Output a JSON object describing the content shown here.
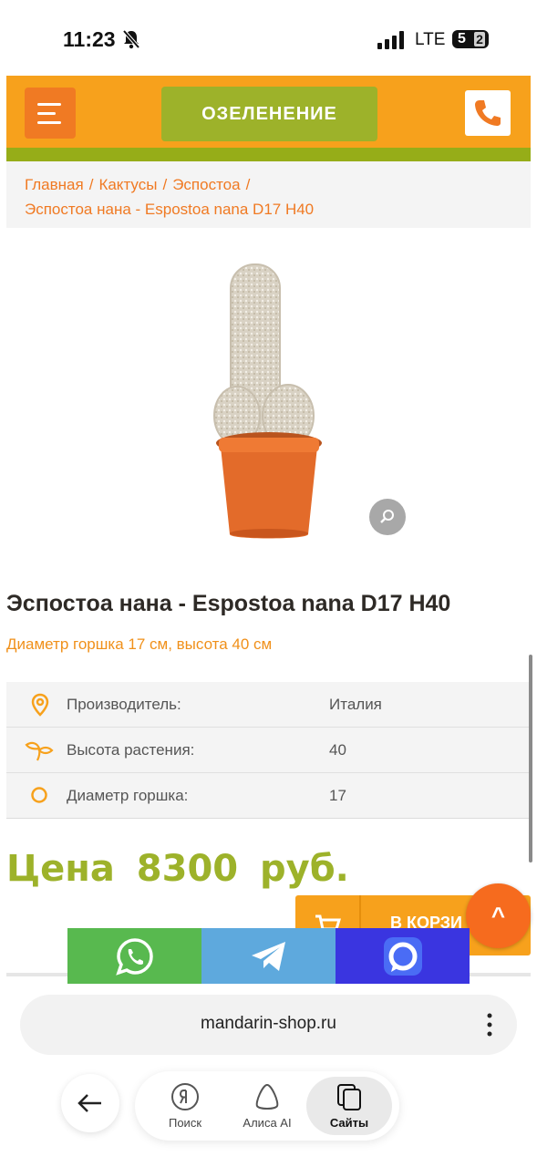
{
  "status_bar": {
    "time": "11:23",
    "network": "LTE",
    "battery": "52",
    "battery_digit_1": "5",
    "battery_digit_2": "2"
  },
  "header": {
    "nav_label": "ОЗЕЛЕНЕНИЕ",
    "brand_color": "#f7a11c",
    "accent_color": "#9db22a"
  },
  "breadcrumb": {
    "items": [
      "Главная",
      "Кактусы",
      "Эспостоа"
    ],
    "current": "Эспостоа нана - Espostoa nana D17 H40",
    "separator": "/"
  },
  "product": {
    "title": "Эспостоа нана - Espostoa nana D17 H40",
    "subtitle": "Диаметр горшка 17 см, высота 40 см",
    "specs": [
      {
        "icon": "location-pin-icon",
        "label": "Производитель:",
        "value": "Италия"
      },
      {
        "icon": "sprout-icon",
        "label": "Высота растения:",
        "value": "40"
      },
      {
        "icon": "circle-icon",
        "label": "Диаметр горшка:",
        "value": "17"
      }
    ],
    "price": "Цена 8300 руб.",
    "cart_label": "В КОРЗИ"
  },
  "scroll_top_label": "^",
  "share": [
    "whatsapp-icon",
    "telegram-icon",
    "max-icon"
  ],
  "browser": {
    "url": "mandarin-shop.ru",
    "nav": [
      {
        "label": "Поиск",
        "icon": "yandex-icon"
      },
      {
        "label": "Алиса AI",
        "icon": "alice-icon"
      },
      {
        "label": "Сайты",
        "icon": "tabs-icon"
      }
    ]
  }
}
